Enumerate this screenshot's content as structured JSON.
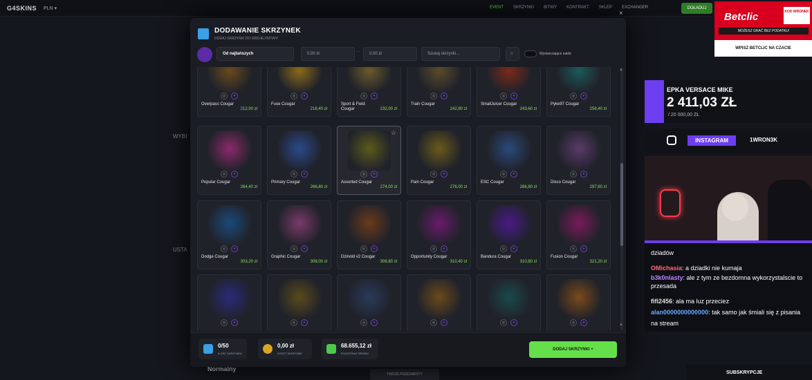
{
  "topbar": {
    "logo": "G4SKINS",
    "currency": "PLN ▾",
    "nav": [
      "EVENT",
      "SKRZYNKI",
      "BITWY",
      "KONTRAKT",
      "SKLEP",
      "EXCHANGER"
    ],
    "deposit_label": "DOŁADUJ"
  },
  "background": {
    "wyb": "WYBI",
    "ust": "USTA",
    "normalny": "Normalny",
    "bottom_tab": "TWOJE PRZEDMIOTY"
  },
  "modal": {
    "title": "DODAWANIE SKRZYNEK",
    "subtitle": "DODAJ SKRZYNKI DO SWOJEJ BITWY!",
    "close": "×",
    "filters": {
      "sort_label": "Od najtańszych",
      "price_from_placeholder": "0,00 zł",
      "price_to_placeholder": "0,00 zł",
      "search_placeholder": "Szukaj skrzynki...",
      "star": "☆",
      "sufficient_balance_label": "Wystarczające saldo"
    },
    "cases": [
      {
        "name": "Overpass Cougar",
        "price": "212,00 zł",
        "color": "#6a4a1c"
      },
      {
        "name": "Fuse Cougar",
        "price": "218,40 zł",
        "color": "#8a6a1a"
      },
      {
        "name": "Sport & Field Cougar",
        "price": "232,00 zł",
        "color": "#6a5a2a"
      },
      {
        "name": "Train Cougar",
        "price": "242,80 zł",
        "color": "#5a4a2a"
      },
      {
        "name": "SmallJuicer Cougar",
        "price": "243,60 zł",
        "color": "#7a2a1a"
      },
      {
        "name": "Pyke97 Cougar",
        "price": "258,40 zł",
        "color": "#1a5a5a"
      },
      {
        "name": "Popular Cougar",
        "price": "264,40 zł",
        "color": "#8a2a6a"
      },
      {
        "name": "Primary Cougar",
        "price": "266,80 zł",
        "color": "#2a4a8a"
      },
      {
        "name": "Assorted Cougar",
        "price": "274,00 zł",
        "color": "#5a5a1a"
      },
      {
        "name": "Pain Cougar",
        "price": "276,00 zł",
        "color": "#6a5a1a"
      },
      {
        "name": "ESC Cougar",
        "price": "286,80 zł",
        "color": "#2a4a7a"
      },
      {
        "name": "Disco Cougar",
        "price": "297,60 zł",
        "color": "#5a3a6a"
      },
      {
        "name": "Dodge Cougar",
        "price": "303,20 zł",
        "color": "#1a4a7a"
      },
      {
        "name": "Graphic Cougar",
        "price": "308,00 zł",
        "color": "#7a3a6a"
      },
      {
        "name": "Dzinold v2 Cougar",
        "price": "308,80 zł",
        "color": "#6a3a1a"
      },
      {
        "name": "Opportunity Cougar",
        "price": "310,40 zł",
        "color": "#6a1a6a"
      },
      {
        "name": "Bandura Cougar",
        "price": "310,80 zł",
        "color": "#4a1a8a"
      },
      {
        "name": "Fusion Cougar",
        "price": "321,20 zł",
        "color": "#7a1a5a"
      },
      {
        "name": "",
        "price": "",
        "color": "#2a2a7a"
      },
      {
        "name": "",
        "price": "",
        "color": "#5a4a1a"
      },
      {
        "name": "",
        "price": "",
        "color": "#2a3a5a"
      },
      {
        "name": "",
        "price": "",
        "color": "#6a4a1a"
      },
      {
        "name": "",
        "price": "",
        "color": "#1a4a4a"
      },
      {
        "name": "",
        "price": "",
        "color": "#7a4a1a"
      }
    ],
    "footer": {
      "count_value": "0/50",
      "count_label": "ILOŚĆ SKRZYNEK",
      "cost_value": "0,00 zł",
      "cost_label": "KOSZT SKRZYNEK",
      "balance_value": "68.655,12 zł",
      "balance_label": "POZOSTAŁE ŚRODKI",
      "add_button": "DODAJ SKRZYNKI +"
    }
  },
  "stream": {
    "betclic_logo": "Betclic",
    "betclic_kod": "KOD WRONEK",
    "betclic_strip": "MOŻESZ GRAĆ BEZ PODATKU!",
    "betclic_bottom": "WPISZ BETCLIC NA CZACIE",
    "donation_name": "EPKA VERSACE MIKE",
    "donation_amount": "2 411,03 ZŁ",
    "donation_goal": "/ 20 000,00 ZŁ",
    "instagram_label": "INSTAGRAM",
    "instagram_handle": "1WRON3K",
    "subs_label": "SUBSKRYPCJE",
    "chat": [
      {
        "user": "",
        "text": "dziadów",
        "color": "#ffffff"
      },
      {
        "user": "OMichasia",
        "text": ": a dziadki nie kumaja",
        "color": "#ff6b7a"
      },
      {
        "user": "b3k0nlasty",
        "text": ": ale z tym ze bezdomna wykorzystalscie to przesada",
        "color": "#c084ff"
      },
      {
        "user": "fifi2456",
        "text": ": ala ma luz przeciez",
        "color": "#e0e0e0"
      },
      {
        "user": "alan0000000000000",
        "text": ": tak samo jak śmiali się z pisania",
        "color": "#6aa8ff"
      },
      {
        "user": "",
        "text": "na stream",
        "color": "#ffffff"
      }
    ]
  }
}
